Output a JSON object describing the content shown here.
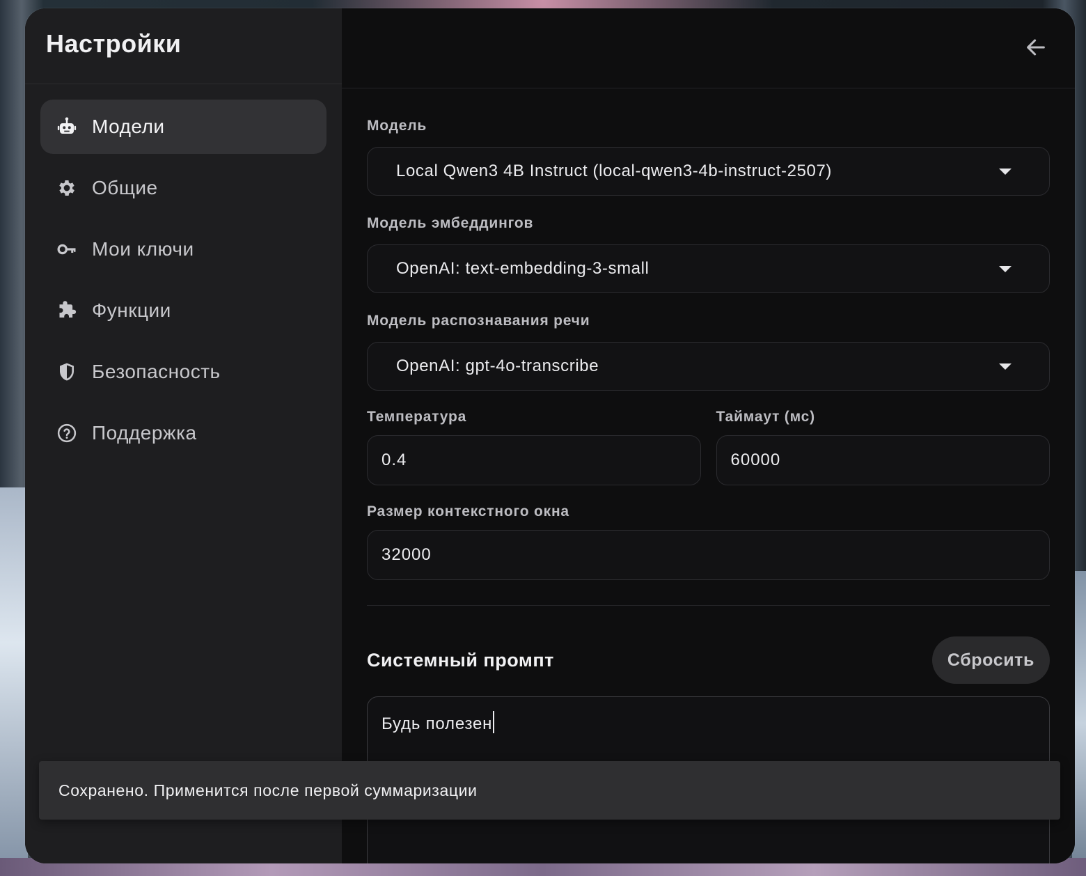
{
  "sidebar": {
    "title": "Настройки",
    "items": [
      {
        "label": "Модели",
        "icon": "robot-icon",
        "active": true
      },
      {
        "label": "Общие",
        "icon": "gear-icon",
        "active": false
      },
      {
        "label": "Мои ключи",
        "icon": "key-icon",
        "active": false
      },
      {
        "label": "Функции",
        "icon": "puzzle-icon",
        "active": false
      },
      {
        "label": "Безопасность",
        "icon": "shield-icon",
        "active": false
      },
      {
        "label": "Поддержка",
        "icon": "help-circle-icon",
        "active": false
      }
    ]
  },
  "header": {
    "back_icon": "arrow-left-icon"
  },
  "form": {
    "model": {
      "label": "Модель",
      "value": "Local Qwen3 4B Instruct (local-qwen3-4b-instruct-2507)"
    },
    "embedding_model": {
      "label": "Модель эмбеддингов",
      "value": "OpenAI: text-embedding-3-small"
    },
    "speech_model": {
      "label": "Модель распознавания речи",
      "value": "OpenAI: gpt-4o-transcribe"
    },
    "temperature": {
      "label": "Температура",
      "value": "0.4"
    },
    "timeout": {
      "label": "Таймаут (мс)",
      "value": "60000"
    },
    "context_window": {
      "label": "Размер контекстного окна",
      "value": "32000"
    }
  },
  "system_prompt": {
    "title": "Системный промпт",
    "reset_label": "Сбросить",
    "value": "Будь полезен"
  },
  "toast": {
    "message": "Сохранено. Применится после первой суммаризации"
  }
}
